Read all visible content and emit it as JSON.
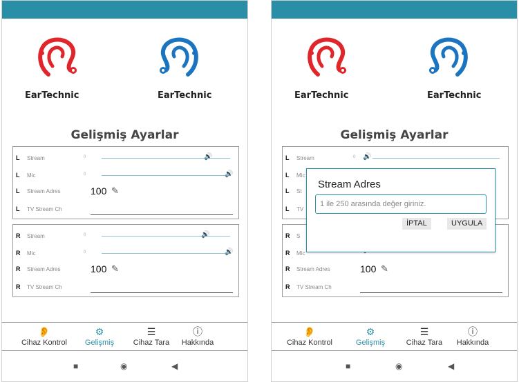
{
  "screens": [
    {
      "brand_left": "EarTechnic",
      "brand_right": "EarTechnic",
      "page_title": "Gelişmiş Ayarlar",
      "left_group": {
        "stream": {
          "side": "L",
          "label": "Stream",
          "zero": "0",
          "level": 0.83
        },
        "mic": {
          "side": "L",
          "label": "Mic",
          "zero": "0",
          "level": 1.0
        },
        "stream_adres": {
          "side": "L",
          "label": "Stream Adres",
          "value": "100"
        },
        "tv_stream": {
          "side": "L",
          "label": "TV Stream Ch"
        }
      },
      "right_group": {
        "stream": {
          "side": "R",
          "label": "Stream",
          "zero": "0",
          "level": 0.83
        },
        "mic": {
          "side": "R",
          "label": "Mic",
          "zero": "0",
          "level": 1.0
        },
        "stream_adres": {
          "side": "R",
          "label": "Stream Adres",
          "value": "100"
        },
        "tv_stream": {
          "side": "R",
          "label": "TV Stream Ch"
        }
      },
      "nav": [
        {
          "label": "Cihaz Kontrol",
          "icon": "ear-icon"
        },
        {
          "label": "Gelişmiş",
          "icon": "gear-icon",
          "active": true
        },
        {
          "label": "Cihaz Tara",
          "icon": "list-icon"
        },
        {
          "label": "Hakkında",
          "icon": "info-icon"
        }
      ]
    },
    {
      "brand_left": "EarTechnic",
      "brand_right": "EarTechnic",
      "page_title": "Gelişmiş Ayarlar",
      "left_group": {
        "stream": {
          "side": "L",
          "label": "Stream",
          "zero": "0",
          "level": 0.05
        },
        "mic": {
          "side": "L",
          "label": "Mic"
        },
        "stream_adres": {
          "side": "L",
          "label": "St"
        },
        "tv_stream": {
          "side": "L",
          "label": "TV"
        }
      },
      "right_group": {
        "stream": {
          "side": "R",
          "label": "S"
        },
        "mic": {
          "side": "R",
          "label": "Mic"
        },
        "stream_adres": {
          "side": "R",
          "label": "Stream Adres",
          "value": "100"
        },
        "tv_stream": {
          "side": "R",
          "label": "TV Stream Ch"
        }
      },
      "dialog": {
        "title": "Stream Adres",
        "placeholder": "1 ile 250 arasında değer giriniz.",
        "cancel_label": "İPTAL",
        "apply_label": "UYGULA"
      },
      "nav": [
        {
          "label": "Cihaz Kontrol",
          "icon": "ear-icon"
        },
        {
          "label": "Gelişmiş",
          "icon": "gear-icon",
          "active": true
        },
        {
          "label": "Cihaz Tara",
          "icon": "list-icon"
        },
        {
          "label": "Hakkında",
          "icon": "info-icon"
        }
      ]
    }
  ],
  "colors": {
    "accent": "#2a8fa6",
    "left_ear": "#e0262b",
    "right_ear": "#1a74c0"
  },
  "system_icons": [
    "square-icon",
    "circle-icon",
    "back-triangle-icon"
  ]
}
